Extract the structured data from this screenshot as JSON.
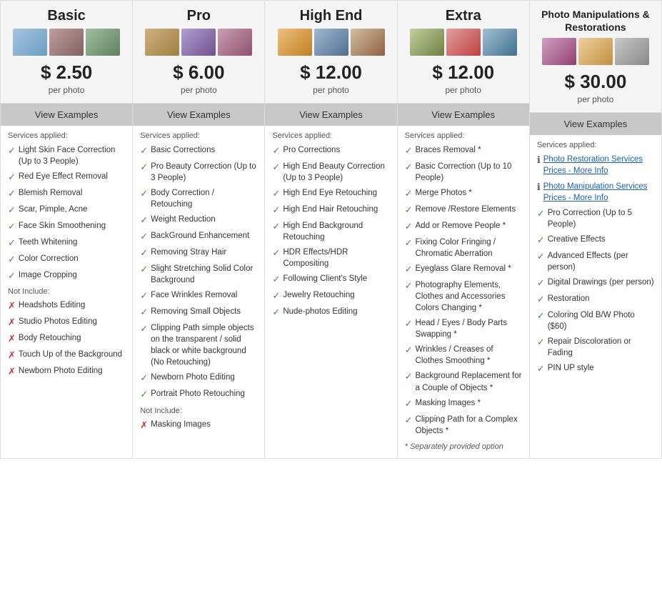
{
  "columns": [
    {
      "id": "basic",
      "title": "Basic",
      "price": "$ 2.50",
      "per_photo": "per photo",
      "view_examples": "View Examples",
      "photos": [
        "p1",
        "p2",
        "p3"
      ],
      "services_label": "Services applied:",
      "included": [
        "Light Skin Face Correction (Up to 3 People)",
        "Red Eye Effect Removal",
        "Blemish Removal",
        "Scar, Pimple, Acne",
        "Face Skin Smoothening",
        "Teeth Whitening",
        "Color Correction",
        "Image Cropping"
      ],
      "not_include_label": "Not Include:",
      "not_included": [
        "Headshots Editing",
        "Studio Photos Editing",
        "Body Retouching",
        "Touch Up of the Background",
        "Newborn Photo Editing"
      ]
    },
    {
      "id": "pro",
      "title": "Pro",
      "price": "$ 6.00",
      "per_photo": "per photo",
      "view_examples": "View Examples",
      "photos": [
        "p4",
        "p5",
        "p6"
      ],
      "services_label": "Services applied:",
      "included": [
        "Basic Corrections",
        "Pro Beauty Correction (Up to 3 People)",
        "Body Correction / Retouching",
        "Weight Reduction",
        "BackGround Enhancement",
        "Removing Stray Hair",
        "Slight Stretching Solid Color Background",
        "Face Wrinkles Removal",
        "Removing Small Objects",
        "Clipping Path simple objects on the transparent / solid black or white background (No Retouching)",
        "Newborn Photo Editing",
        "Portrait Photo Retouching"
      ],
      "not_include_label": "Not Include:",
      "not_included": [
        "Masking Images"
      ]
    },
    {
      "id": "high-end",
      "title": "High End",
      "price": "$ 12.00",
      "per_photo": "per photo",
      "view_examples": "View Examples",
      "photos": [
        "p7",
        "p8",
        "p9"
      ],
      "services_label": "Services applied:",
      "included": [
        "Pro Corrections",
        "High End Beauty Correction (Up to 3 People)",
        "High End Eye Retouching",
        "High End Hair Retouching",
        "High End Background Retouching",
        "HDR Effects/HDR Compositing",
        "Following Client's Style",
        "Jewelry Retouching",
        "Nude-photos Editing"
      ],
      "not_include_label": null,
      "not_included": []
    },
    {
      "id": "extra",
      "title": "Extra",
      "price": "$ 12.00",
      "per_photo": "per photo",
      "view_examples": "View Examples",
      "photos": [
        "p10",
        "p11",
        "p12"
      ],
      "services_label": "Services applied:",
      "included": [
        "Braces Removal *",
        "Basic Correction (Up to 10 People)",
        "Merge Photos *",
        "Remove /Restore Elements",
        "Add or Remove People *",
        "Fixing Color Fringing / Chromatic Aberration",
        "Eyeglass Glare Removal *",
        "Photography Elements, Clothes and Accessories Colors Changing *",
        "Head / Eyes / Body Parts Swapping *",
        "Wrinkles / Creases of Clothes Smoothing *",
        "Background Replacement for a Couple of Objects *",
        "Masking Images *",
        "Clipping Path for a Complex Objects *"
      ],
      "not_include_label": null,
      "not_included": [],
      "footer_note": "* Separately provided option"
    },
    {
      "id": "manipulations",
      "title": "Photo Manipulations & Restorations",
      "price": "$ 30.00",
      "per_photo": "per photo",
      "view_examples": "View Examples",
      "photos": [
        "p13",
        "p14",
        "p15"
      ],
      "services_label": "Services applied:",
      "info_items": [
        {
          "label": "Photo Restoration Services",
          "sub": "Prices - More Info"
        },
        {
          "label": "Photo Manipulation Services",
          "sub": "Prices - More Info"
        }
      ],
      "included": [
        "Pro Correction (Up to 5 People)",
        "Creative Effects",
        "Advanced Effects (per person)",
        "Digital Drawings (per person)",
        "Restoration",
        "Coloring Old B/W Photo ($60)",
        "Repair Discoloration or Fading",
        "PIN UP style"
      ],
      "not_include_label": null,
      "not_included": []
    }
  ]
}
